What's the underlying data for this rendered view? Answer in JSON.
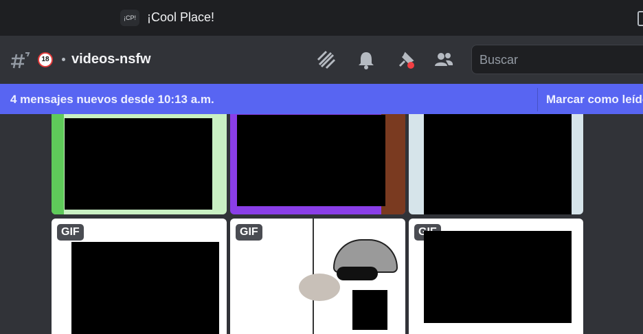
{
  "titlebar": {
    "server_icon_text": "¡CP!",
    "server_name": "¡Cool Place!"
  },
  "channel": {
    "name": "videos-nsfw",
    "age_badge": "18",
    "icons": [
      "threads-icon",
      "bell-icon",
      "pin-icon",
      "members-icon"
    ],
    "search_placeholder": "Buscar"
  },
  "banner": {
    "text": "4 mensajes nuevos desde 10:13 a.m.",
    "action": "Marcar como leído"
  },
  "media": {
    "gif_label": "GIF",
    "tiles": [
      {
        "row": 1,
        "col": 1,
        "badge": ""
      },
      {
        "row": 1,
        "col": 2,
        "badge": ""
      },
      {
        "row": 1,
        "col": 3,
        "badge": ""
      },
      {
        "row": 2,
        "col": 1,
        "badge": "GIF"
      },
      {
        "row": 2,
        "col": 2,
        "badge": "GIF"
      },
      {
        "row": 2,
        "col": 3,
        "badge": "GIF"
      }
    ]
  },
  "colors": {
    "accent": "#5865f2",
    "background": "#313338",
    "titlebar": "#1e1f22"
  }
}
